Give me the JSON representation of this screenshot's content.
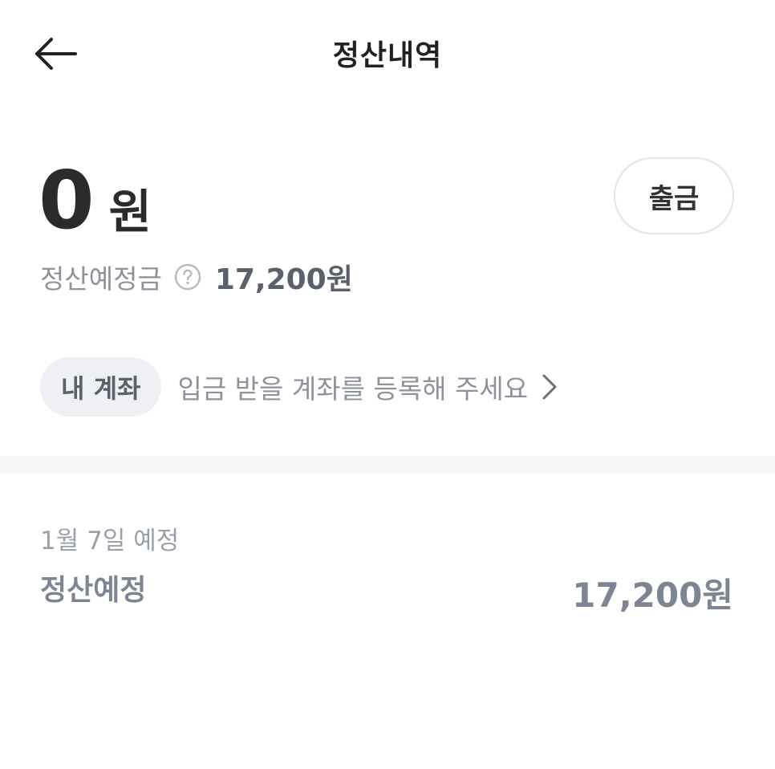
{
  "header": {
    "title": "정산내역",
    "back_icon": "arrow-left-icon"
  },
  "balance": {
    "amount": "0",
    "unit": "원",
    "withdraw_label": "출금"
  },
  "expected": {
    "label": "정산예정금",
    "help_icon": "question-circle-icon",
    "value": "17,200원"
  },
  "account": {
    "chip_label": "내 계좌",
    "prompt": "입금 받을 계좌를 등록해 주세요",
    "chevron_icon": "chevron-right-icon"
  },
  "settlements": [
    {
      "date": "1월 7일 예정",
      "status": "정산예정",
      "amount": "17,200원"
    }
  ],
  "colors": {
    "primary_text": "#222222",
    "muted_text": "#8e939b",
    "chip_bg": "#eef0f4",
    "divider_bg": "#f5f6f8"
  }
}
